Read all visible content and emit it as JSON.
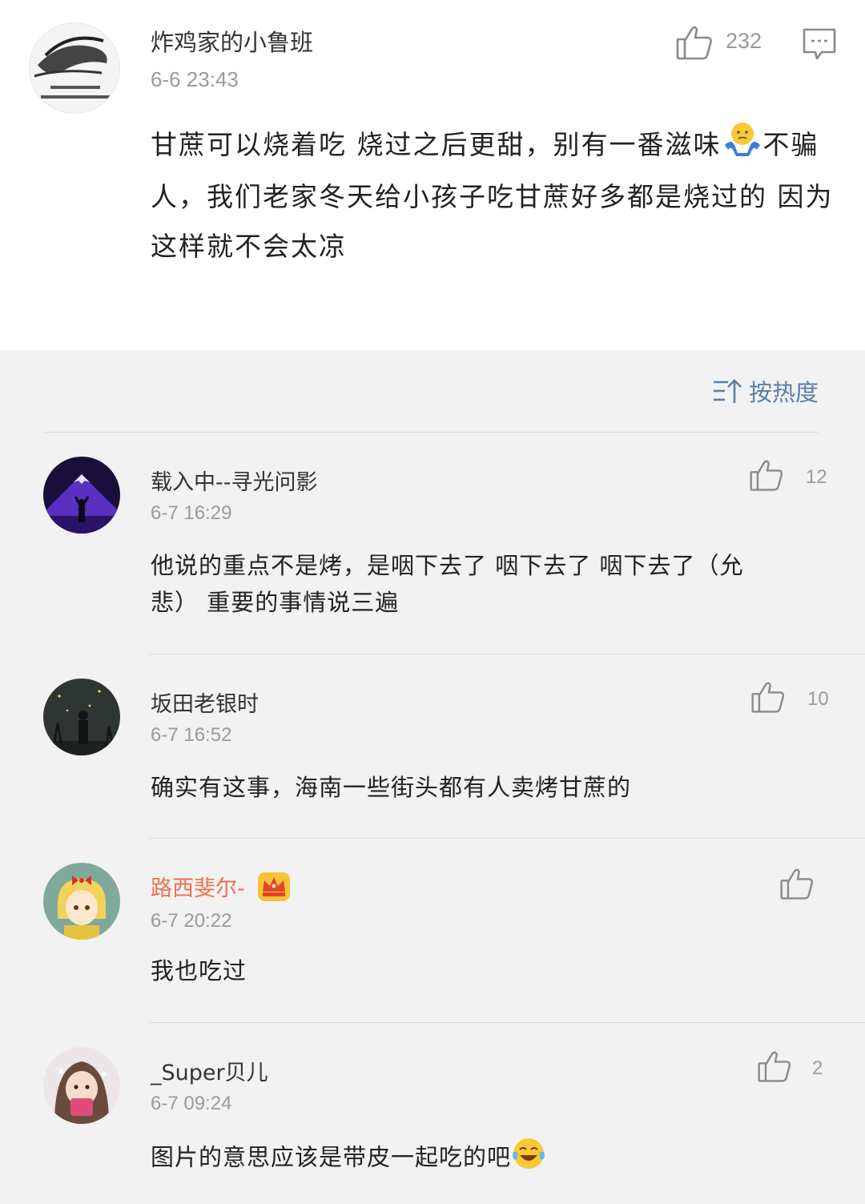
{
  "main_comment": {
    "username": "炸鸡家的小鲁班",
    "timestamp": "6-6 23:43",
    "like_count": "232",
    "text_part1": "甘蔗可以烧着吃 烧过之后更甜，别有一番滋味",
    "emoji": "shrug-emoji",
    "text_part2": "不骗人，我们老家冬天给小孩子吃甘蔗好多都是烧过的 因为这样就不会太凉",
    "icons": {
      "like": "thumbs-up-icon",
      "reply": "comment-bubble-icon"
    }
  },
  "sort": {
    "label": "按热度",
    "icon": "sort-icon"
  },
  "replies": [
    {
      "username": "载入中--寻光问影",
      "timestamp": "6-7 16:29",
      "like_count": "12",
      "text": "他说的重点不是烤，是咽下去了 咽下去了 咽下去了（允悲） 重要的事情说三遍"
    },
    {
      "username": "坂田老银时",
      "timestamp": "6-7 16:52",
      "like_count": "10",
      "text": "确实有这事，海南一些街头都有人卖烤甘蔗的"
    },
    {
      "username": "路西斐尔-",
      "timestamp": "6-7 20:22",
      "like_count": "",
      "text": "我也吃过",
      "badge": "crown-badge-icon"
    },
    {
      "username": "_Super贝儿",
      "timestamp": "6-7 09:24",
      "like_count": "2",
      "text": "图片的意思应该是带皮一起吃的吧",
      "emoji": "laughing-tears-emoji"
    }
  ],
  "colors": {
    "vip_name": "#eb7350",
    "link_blue": "#5a7eaa",
    "meta_gray": "#9a9a9a",
    "background": "#f2f2f2"
  }
}
